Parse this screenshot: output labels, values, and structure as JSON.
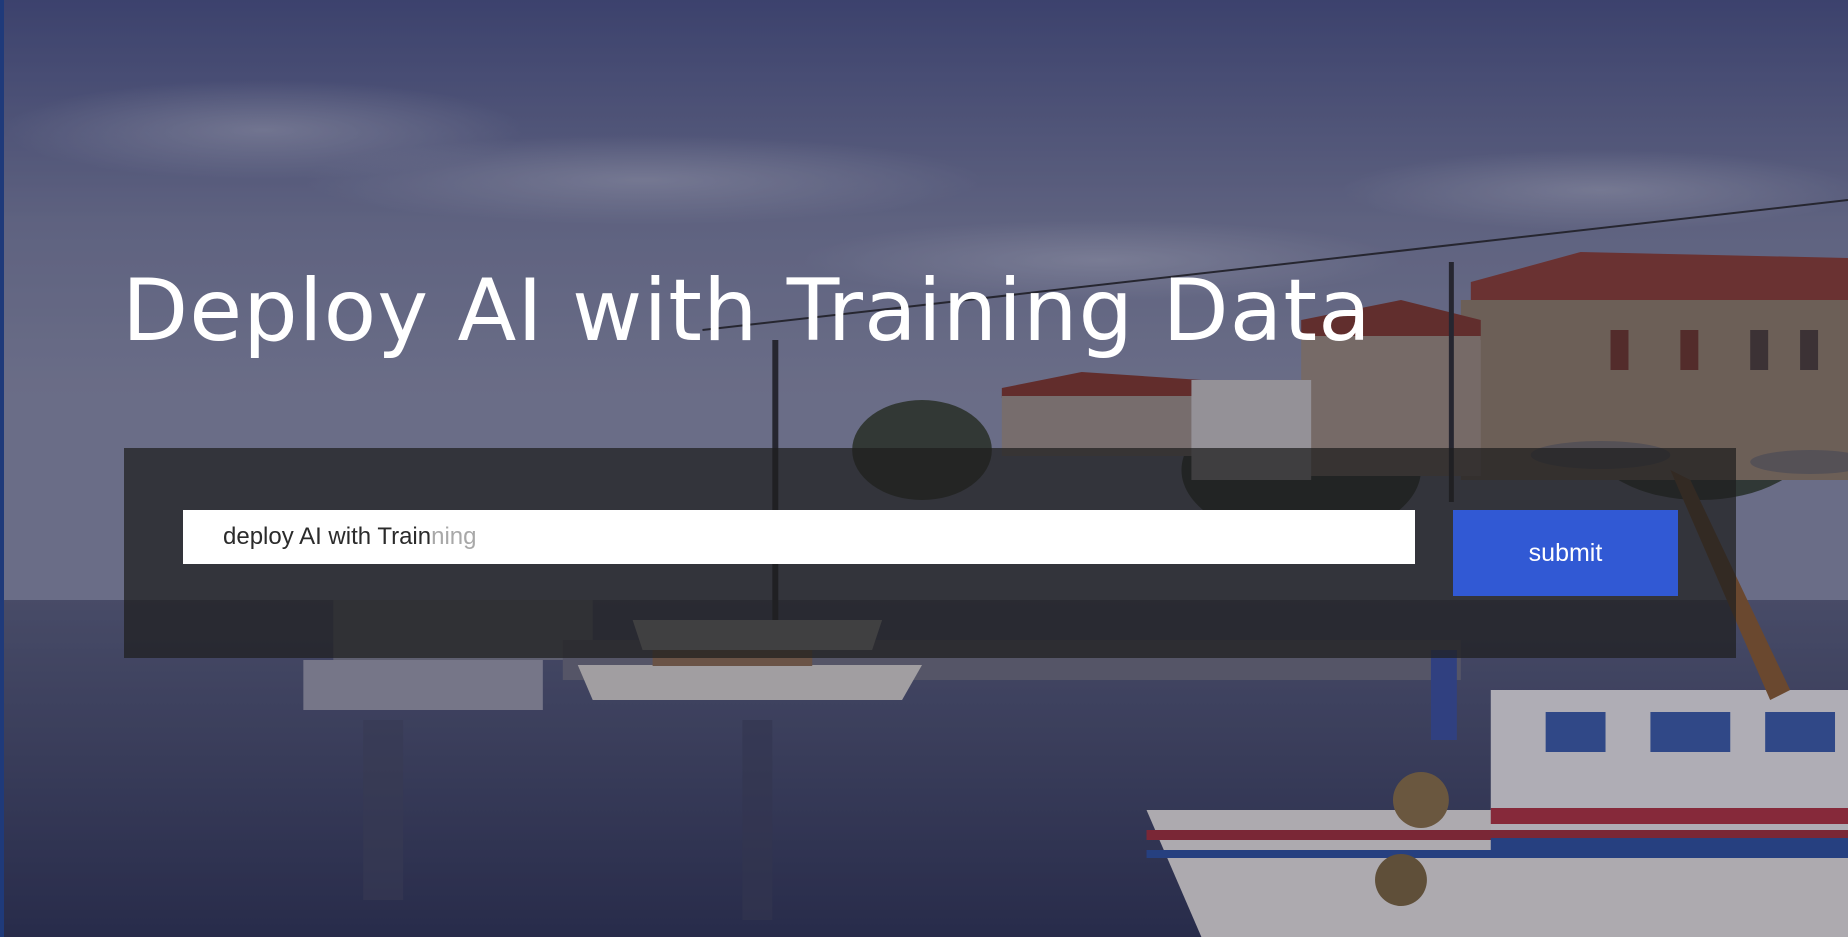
{
  "hero": {
    "title": "Deploy AI with Training Data",
    "background": "harbor-photo"
  },
  "search": {
    "typed_text": "deploy AI with Train",
    "suggestion_text": "ning",
    "submit_label": "submit"
  },
  "colors": {
    "accent": "#3159d4",
    "panel": "#1e1e1e",
    "text": "#ffffff"
  }
}
